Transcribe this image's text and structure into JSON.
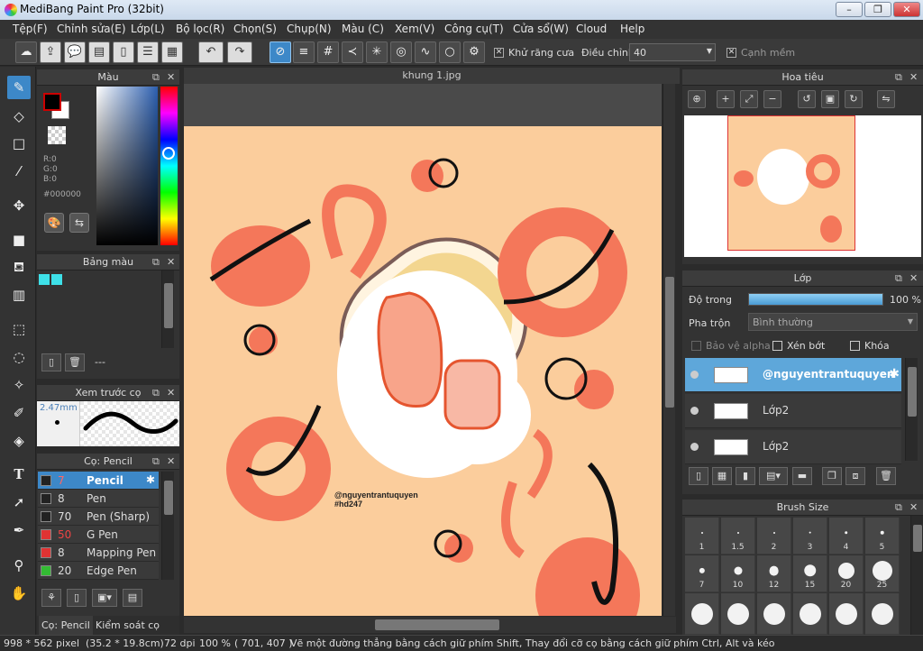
{
  "window": {
    "title": "MediBang Paint Pro (32bit)",
    "buttons": [
      "–",
      "❐",
      "✕"
    ]
  },
  "menu": [
    "Tệp(F)",
    "Chỉnh sửa(E)",
    "Lớp(L)",
    "Bộ lọc(R)",
    "Chọn(S)",
    "Chụp(N)",
    "Màu (C)",
    "Xem(V)",
    "Công cụ(T)",
    "Cửa sổ(W)",
    "Cloud",
    "Help"
  ],
  "toolbar": {
    "antialias_label": "Khử răng cưa",
    "adjust_label": "Điều chỉnh",
    "adjust_value": "40",
    "smooth_label": "Cạnh mềm",
    "icons": [
      "cloud-upload-icon",
      "export-icon",
      "speech-bubble-icon",
      "comment-icon",
      "page-icon",
      "layers-list-icon",
      "grid-icon",
      "undo-icon",
      "redo-icon",
      "no-snap-icon",
      "parallel-snap-icon",
      "grid-snap-icon",
      "vanishing-snap-icon",
      "radial-snap-icon",
      "concentric-snap-icon",
      "curve-snap-icon",
      "circle-snap-icon",
      "snap-settings-icon"
    ]
  },
  "tools": [
    "brush-icon",
    "eraser-icon",
    "rectangle-select-icon",
    "dot-brush-icon",
    "move-icon",
    "fill-rect-icon",
    "bucket-fill-icon",
    "gradient-icon",
    "select-rect-icon",
    "lasso-icon",
    "magic-wand-icon",
    "select-pen-icon",
    "select-eraser-icon",
    "text-icon",
    "operation-icon",
    "eyedropper-icon",
    "hand-icon"
  ],
  "color_panel": {
    "title": "Màu",
    "r": "R:0",
    "g": "G:0",
    "b": "B:0",
    "hex": "#000000"
  },
  "palette_panel": {
    "title": "Bảng màu",
    "swatch_color": "#3ee0e8",
    "footer": "---"
  },
  "preview_panel": {
    "title": "Xem trước cọ",
    "size": "2.47mm"
  },
  "brush_panel": {
    "title": "Cọ: Pencil",
    "items": [
      {
        "size": "7",
        "name": "Pencil",
        "color": "#222222"
      },
      {
        "size": "8",
        "name": "Pen",
        "color": "#222222"
      },
      {
        "size": "70",
        "name": "Pen (Sharp)",
        "color": "#222222"
      },
      {
        "size": "50",
        "name": "G Pen",
        "color": "#e03333"
      },
      {
        "size": "8",
        "name": "Mapping Pen",
        "color": "#e03333"
      },
      {
        "size": "20",
        "name": "Edge Pen",
        "color": "#33bb33"
      }
    ],
    "tabs": [
      "Cọ: Pencil",
      "Kiểm soát cọ"
    ]
  },
  "canvas": {
    "tab": "khung 1.jpg",
    "bg_color": "#fbcd9c",
    "accent_color": "#f4775a",
    "watermark_line1": "@nguyentrantuquyen",
    "watermark_line2": "#hd247"
  },
  "navigator": {
    "title": "Hoa tiêu"
  },
  "layer_panel": {
    "title": "Lớp",
    "opacity_label": "Độ trong",
    "opacity_value": "100 %",
    "opacity_fraction": 1.0,
    "blend_label": "Pha trộn",
    "blend_value": "Bình thường",
    "protect_alpha": "Bảo vệ alpha",
    "clipping": "Xén bớt",
    "lock": "Khóa",
    "layers": [
      {
        "name": "@nguyentrantuquyen",
        "selected": true
      },
      {
        "name": "Lớp2",
        "selected": false
      },
      {
        "name": "Lớp2",
        "selected": false
      }
    ]
  },
  "brush_size_panel": {
    "title": "Brush Size",
    "sizes": [
      "1",
      "1.5",
      "2",
      "3",
      "4",
      "5",
      "7",
      "10",
      "12",
      "15",
      "20",
      "25"
    ]
  },
  "status": {
    "dims": "998 * 562 pixel",
    "physical": "(35.2 * 19.8cm)",
    "dpi": "72 dpi",
    "zoom": "100 %",
    "coords": "( 701, 407 )",
    "hint": "Vẽ một đường thẳng bằng cách giữ phím Shift, Thay đổi cỡ cọ bằng cách giữ phím Ctrl, Alt và kéo"
  }
}
